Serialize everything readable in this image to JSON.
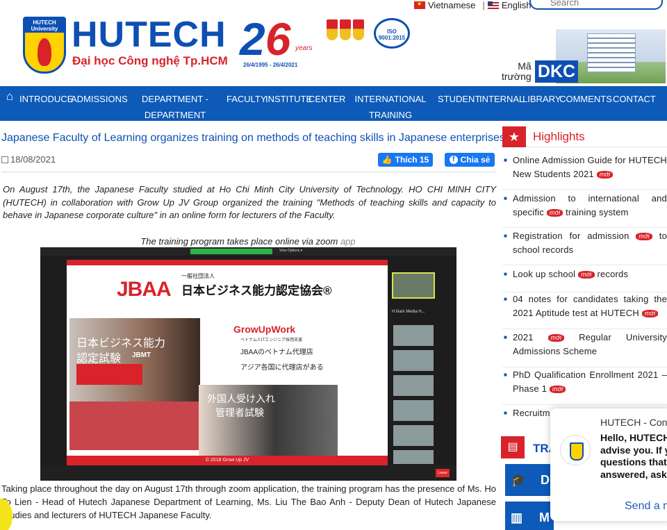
{
  "topbar": {
    "lang_vi": "Vietnamese",
    "lang_en": "English",
    "search_placeholder": "Search"
  },
  "header": {
    "logo_top": "HUTECH University",
    "brand": "HUTECH",
    "brand_sub": "Đại học Công nghệ Tp.HCM",
    "anniv_number_2": "2",
    "anniv_number_6": "6",
    "anniv_years": "years",
    "anniv_dates": "26/4/1995 - 26/4/2021",
    "iso_label": "ISO 9001:2015",
    "matruong_1": "Mã",
    "matruong_2": "trường",
    "dkc": "DKC"
  },
  "nav": {
    "items": [
      {
        "label": "Introduce"
      },
      {
        "label": "Admissions"
      },
      {
        "label": "Department -",
        "label2": "Department"
      },
      {
        "label": "Faculty"
      },
      {
        "label": "Institute"
      },
      {
        "label": "Center"
      },
      {
        "label": "International",
        "label2": "Training"
      },
      {
        "label": "Student"
      },
      {
        "label": "Internal"
      },
      {
        "label": "Library"
      },
      {
        "label": "Comments"
      },
      {
        "label": "Contact"
      }
    ]
  },
  "article": {
    "title": "Japanese Faculty of Learning organizes training on methods of teaching skills in Japanese enterprises",
    "date": "18/08/2021",
    "like_label": "Thích 15",
    "share_label": "Chia sẻ",
    "intro": "On August 17th, the Japanese Faculty studied at Ho Chi Minh City University of Technology. HO CHI MINH CITY (HUTECH) in collaboration with Grow Up JV Group organized the training \"Methods of teaching skills and capacity to behave in Japanese corporate culture\" in an online form for lecturers of the Faculty.",
    "caption": "The training program takes place online via zoom",
    "caption_app": "app",
    "body": "Taking place throughout the day on August 17th through zoom application, the training program has the presence of Ms. Ho To Lien - Head of Hutech Japanese Department of Learning, Ms. Liu The Bao Anh - Deputy Dean of Hutech Japanese Studies and lecturers of HUTECH Japanese Faculty."
  },
  "zoom": {
    "view_options": "View Options ▾",
    "view": "View",
    "slide_jbaa": "JBAA",
    "slide_org_small": "一般社団法人",
    "slide_org": "日本ビジネス能力認定協会®",
    "slide_text1": "日本ビジネス能力",
    "slide_text2": "認定試験",
    "slide_jbmt": "JBMT",
    "growup": "GrowUpWork",
    "growup_sub": "ベトナム人ITエンジニア採用支援",
    "jline1": "JBAAのベトナム代理店",
    "jline2": "アジア各国に代理店がある",
    "slide_text3": "外国人受け入れ",
    "slide_text4": "管理者試験",
    "slide_footer": "© 2018 Grow Up JV",
    "pane_label": "H.Nam Media H...",
    "leave": "Leave"
  },
  "sidebar": {
    "highlights_title": "Highlights",
    "new_badge": "mới",
    "items": [
      {
        "text": "Online Admission Guide for HUTECH New Students 2021"
      },
      {
        "text": "Admission to international and specific",
        "text2": "training system"
      },
      {
        "text": "Registration for admission",
        "text2": "to school records"
      },
      {
        "text": "Look up school",
        "text2": "records"
      },
      {
        "text": "04 notes for candidates taking the 2021 Aptitude test at HUTECH"
      },
      {
        "text": "2021",
        "text2": "Regular University Admissions Scheme"
      },
      {
        "text": "PhD Qualification Enrollment 2021 – Phase 1"
      },
      {
        "text": "Recruitmen"
      }
    ],
    "training_title": "TRA",
    "tile1": "D",
    "tile2": "M"
  },
  "chat": {
    "name": "HUTECH - Cons",
    "line1": "Hello, HUTECH",
    "line2": "advise you. If y",
    "line3": "questions that",
    "line4": "answered, ask",
    "send": "Send a m"
  }
}
